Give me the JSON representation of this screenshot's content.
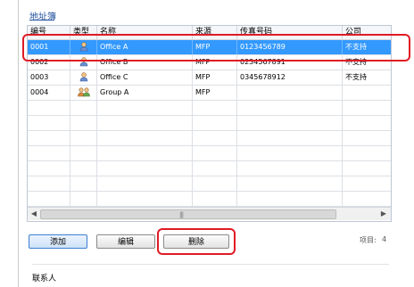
{
  "panel": {
    "title": "地址簿"
  },
  "table": {
    "columns": [
      "编号",
      "类型",
      "名称",
      "来源",
      "传真号码",
      "公司"
    ],
    "rows": [
      {
        "id": "0001",
        "type": "person",
        "name": "Office A",
        "source": "MFP",
        "fax": "0123456789",
        "company": "不支持",
        "selected": true
      },
      {
        "id": "0002",
        "type": "person",
        "name": "Office B",
        "source": "MFP",
        "fax": "0234567891",
        "company": "不支持",
        "selected": false
      },
      {
        "id": "0003",
        "type": "person",
        "name": "Office C",
        "source": "MFP",
        "fax": "0345678912",
        "company": "不支持",
        "selected": false
      },
      {
        "id": "0004",
        "type": "group",
        "name": "Group A",
        "source": "MFP",
        "fax": "",
        "company": "",
        "selected": false
      }
    ],
    "empty_rows": 7
  },
  "buttons": {
    "add": "添加",
    "edit": "编辑",
    "delete": "删除"
  },
  "footer": {
    "count_label": "项目:",
    "count_value": "4"
  },
  "contacts": {
    "label": "联系人"
  },
  "icons": {
    "person": "person-icon",
    "group": "group-icon",
    "scroll_left": "chevron-left-icon",
    "scroll_right": "chevron-right-icon"
  },
  "colors": {
    "selection": "#3399ff",
    "highlight": "#e01b24",
    "accent": "#1f4f9e"
  }
}
